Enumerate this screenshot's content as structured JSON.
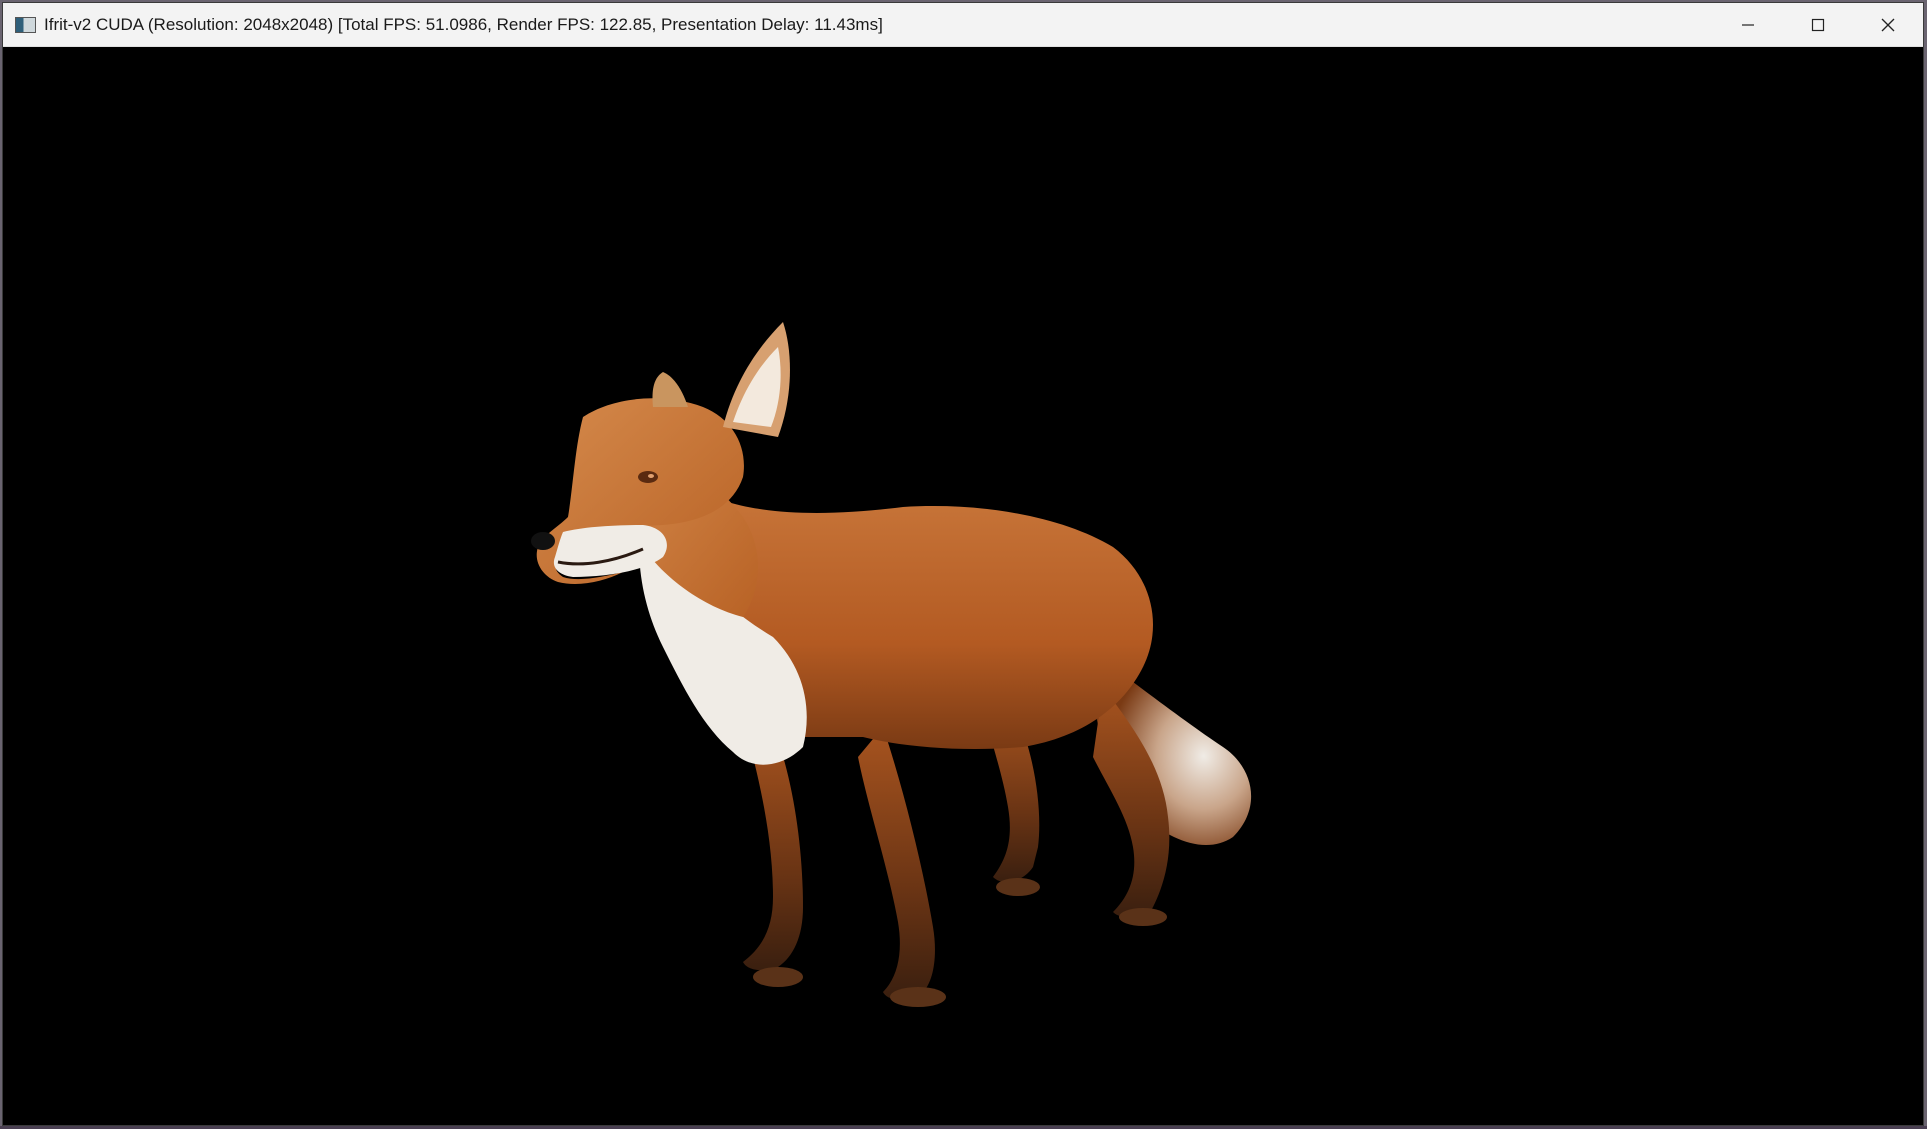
{
  "window": {
    "title": "Ifrit-v2 CUDA (Resolution: 2048x2048) [Total FPS: 51.0986, Render FPS: 122.85, Presentation Delay: 11.43ms]",
    "app_icon": "app-window-icon",
    "controls": {
      "minimize_icon": "minimize-icon",
      "maximize_icon": "maximize-icon",
      "close_icon": "close-icon"
    }
  },
  "viewport": {
    "background": "#000000",
    "subject": "fox-3d-model",
    "colors": {
      "fur_orange": "#c2652a",
      "fur_dark": "#7a3a14",
      "fur_white": "#f0ece6",
      "nose": "#111111"
    }
  }
}
